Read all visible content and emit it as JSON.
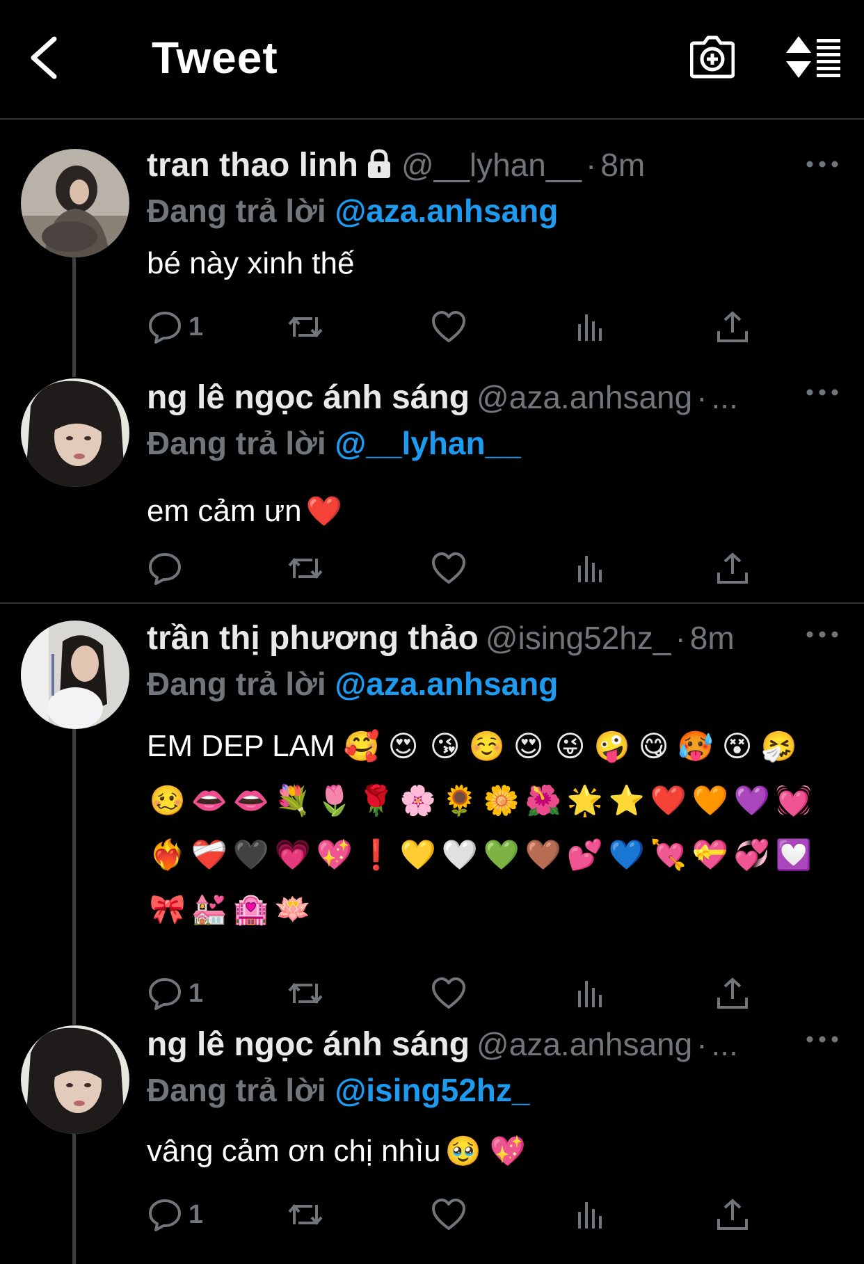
{
  "header": {
    "title": "Tweet"
  },
  "tweets": [
    {
      "display_name": "tran thao linh",
      "protected": true,
      "handle": "@__lyhan__",
      "sep": "·",
      "time": "8m",
      "reply_prefix": "Đang trả lời",
      "reply_to": "@aza.anhsang",
      "text": "bé này xinh thế",
      "reply_count": "1"
    },
    {
      "display_name": "ng lê ngọc ánh sáng",
      "handle": "@aza.anhsang",
      "sep": "·",
      "time": "...",
      "reply_prefix": "Đang trả lời",
      "reply_to": "@__lyhan__",
      "text": "em cảm ưn",
      "text_emoji": "❤️",
      "reply_count": ""
    },
    {
      "display_name": "trần thị phương thảo",
      "handle": "@ising52hz_",
      "sep": "·",
      "time": "8m",
      "reply_prefix": "Đang trả lời",
      "reply_to": "@aza.anhsang",
      "text": "EM DEP LAM",
      "emojis": [
        "🥰",
        "😍",
        "😘",
        "☺️",
        "😍",
        "😜",
        "🤪",
        "😋",
        "🥵",
        "😵",
        "🤧",
        "🥴",
        "👄",
        "👄",
        "💐",
        "🌷",
        "🌹",
        "🌸",
        "🌻",
        "🌼",
        "🌺",
        "🌟",
        "⭐",
        "❤️",
        "🧡",
        "💜",
        "💓",
        "❤️‍🔥",
        "❤️‍🩹",
        "🖤",
        "💗",
        "💖",
        "❗",
        "💛",
        "🤍",
        "💚",
        "🤎",
        "💕",
        "💙",
        "💘",
        "💝",
        "💞",
        "💟",
        "🎀",
        "💒",
        "🏩",
        "🪷"
      ],
      "reply_count": "1"
    },
    {
      "display_name": "ng lê ngọc ánh sáng",
      "handle": "@aza.anhsang",
      "sep": "·",
      "time": "...",
      "reply_prefix": "Đang trả lời",
      "reply_to": "@ising52hz_",
      "text": "vâng cảm ơn chị nhìu",
      "text_emoji": "🥹 💖",
      "reply_count": "1"
    }
  ],
  "icons": {
    "back": "chevron-left-icon",
    "camera": "camera-plus-icon",
    "sort": "sort-icon",
    "lock": "lock-icon",
    "more": "more-dots-icon",
    "reply": "reply-icon",
    "retweet": "retweet-icon",
    "like": "heart-icon",
    "views": "views-icon",
    "share": "share-icon"
  },
  "colors": {
    "background": "#000000",
    "text": "#e7e9ea",
    "muted": "#71767b",
    "link": "#1d9bf0",
    "divider": "#2f3336"
  }
}
